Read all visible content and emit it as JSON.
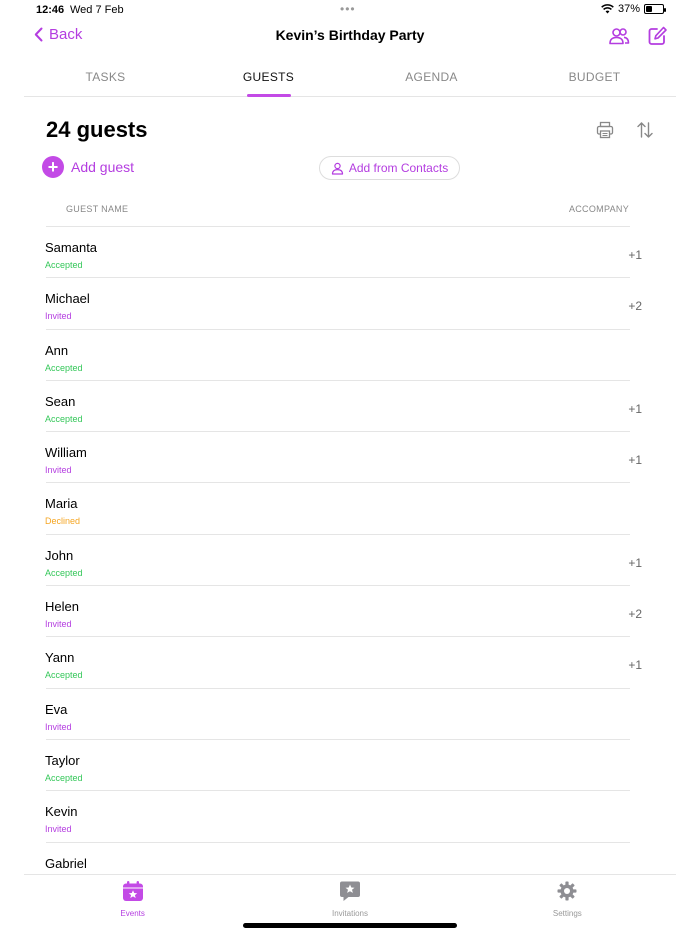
{
  "status_bar": {
    "time": "12:46",
    "date": "Wed 7 Feb",
    "battery": "37%",
    "battery_level": 0.37
  },
  "nav": {
    "back_label": "Back",
    "title": "Kevin’s Birthday Party"
  },
  "tabs": [
    {
      "label": "TASKS",
      "active": false
    },
    {
      "label": "GUESTS",
      "active": true
    },
    {
      "label": "AGENDA",
      "active": false
    },
    {
      "label": "BUDGET",
      "active": false
    }
  ],
  "guests_header": {
    "count_label": "24 guests",
    "add_guest_label": "Add guest",
    "add_contacts_label": "Add from Contacts",
    "col_name": "GUEST NAME",
    "col_accompany": "ACCOMPANY"
  },
  "status_colors": {
    "Accepted": "#34c759",
    "Invited": "#b43de0",
    "Declined": "#f5a623"
  },
  "guests": [
    {
      "name": "Samanta",
      "status": "Accepted",
      "accompany": "+1"
    },
    {
      "name": "Michael",
      "status": "Invited",
      "accompany": "+2"
    },
    {
      "name": "Ann",
      "status": "Accepted",
      "accompany": ""
    },
    {
      "name": "Sean",
      "status": "Accepted",
      "accompany": "+1"
    },
    {
      "name": "William",
      "status": "Invited",
      "accompany": "+1"
    },
    {
      "name": "Maria",
      "status": "Declined",
      "accompany": ""
    },
    {
      "name": "John",
      "status": "Accepted",
      "accompany": "+1"
    },
    {
      "name": "Helen",
      "status": "Invited",
      "accompany": "+2"
    },
    {
      "name": "Yann",
      "status": "Accepted",
      "accompany": "+1"
    },
    {
      "name": "Eva",
      "status": "Invited",
      "accompany": ""
    },
    {
      "name": "Taylor",
      "status": "Accepted",
      "accompany": ""
    },
    {
      "name": "Kevin",
      "status": "Invited",
      "accompany": ""
    },
    {
      "name": "Gabriel",
      "status": "",
      "accompany": ""
    }
  ],
  "tab_bar": [
    {
      "label": "Events",
      "icon": "calendar-star-icon",
      "active": true
    },
    {
      "label": "Invitations",
      "icon": "chat-star-icon",
      "active": false
    },
    {
      "label": "Settings",
      "icon": "gear-icon",
      "active": false
    }
  ]
}
